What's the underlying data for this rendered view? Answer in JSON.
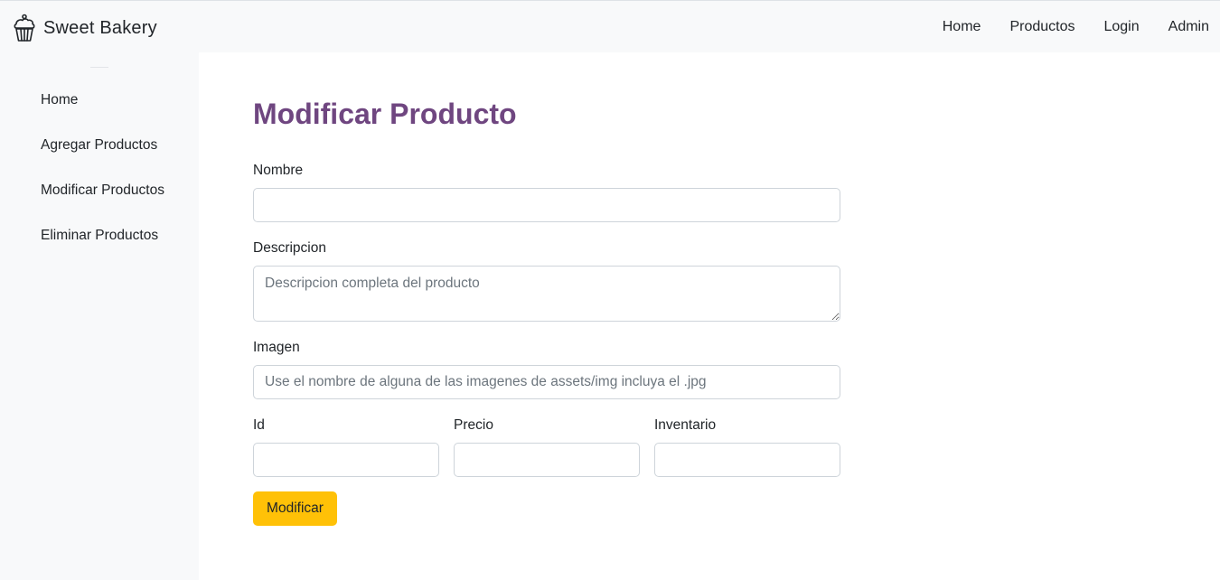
{
  "navbar": {
    "brand_icon": "cupcake-icon",
    "brand_name": "Sweet Bakery",
    "links": [
      "Home",
      "Productos",
      "Login",
      "Admin"
    ]
  },
  "sidebar": {
    "items": [
      "Home",
      "Agregar Productos",
      "Modificar Productos",
      "Eliminar Productos"
    ]
  },
  "form": {
    "title": "Modificar Producto",
    "nombre": {
      "label": "Nombre",
      "value": "",
      "placeholder": ""
    },
    "descripcion": {
      "label": "Descripcion",
      "value": "",
      "placeholder": "Descripcion completa del producto"
    },
    "imagen": {
      "label": "Imagen",
      "value": "",
      "placeholder": "Use el nombre de alguna de las imagenes de assets/img incluya el .jpg"
    },
    "id": {
      "label": "Id",
      "value": ""
    },
    "precio": {
      "label": "Precio",
      "value": ""
    },
    "inventario": {
      "label": "Inventario",
      "value": ""
    },
    "submit_label": "Modificar"
  },
  "colors": {
    "title": "#6f4680",
    "submit_button": "#ffc107",
    "chrome_background": "#f8f9fa"
  }
}
